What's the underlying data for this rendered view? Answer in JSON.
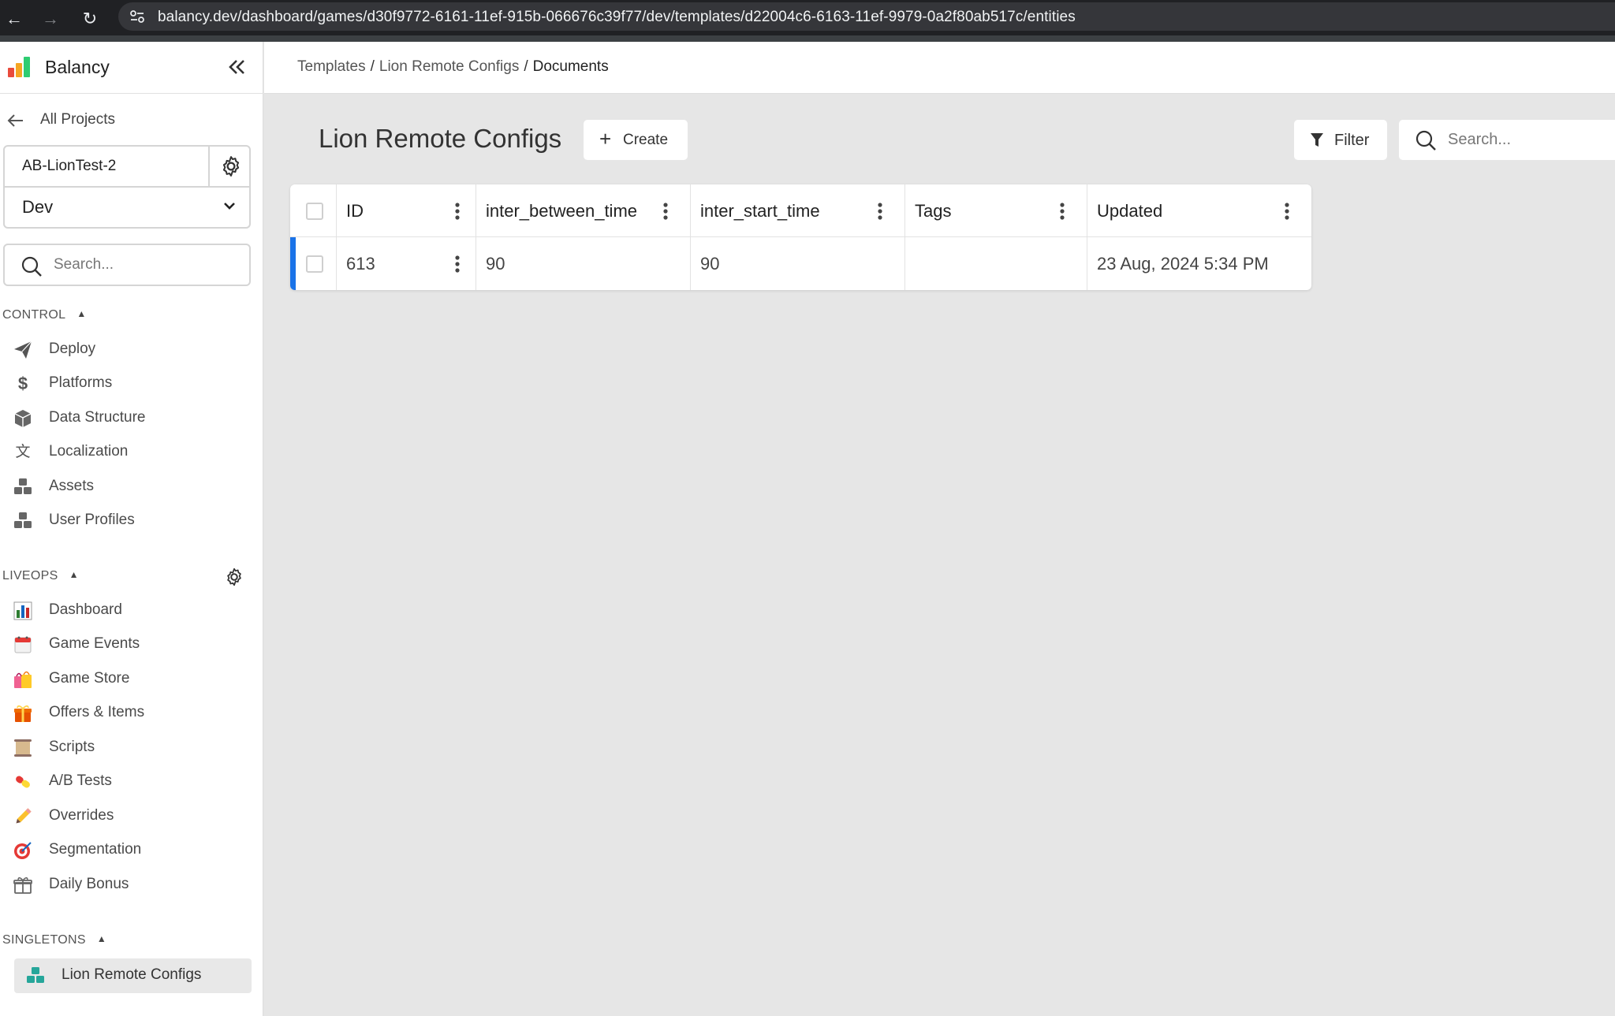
{
  "browser": {
    "url": "balancy.dev/dashboard/games/d30f9772-6161-11ef-915b-066676c39f77/dev/templates/d22004c6-6163-11ef-9979-0a2f80ab517c/entities"
  },
  "sidebar": {
    "brand": "Balancy",
    "all_projects": "All Projects",
    "project_name": "AB-LionTest-2",
    "environment": "Dev",
    "search_placeholder": "Search...",
    "control": {
      "title": "CONTROL",
      "items": [
        {
          "label": "Deploy",
          "icon": "paper-plane-icon"
        },
        {
          "label": "Platforms",
          "icon": "dollar-icon"
        },
        {
          "label": "Data Structure",
          "icon": "cube-icon"
        },
        {
          "label": "Localization",
          "icon": "translate-icon"
        },
        {
          "label": "Assets",
          "icon": "cubes-icon"
        },
        {
          "label": "User Profiles",
          "icon": "cubes-icon"
        }
      ]
    },
    "liveops": {
      "title": "LIVEOPS",
      "items": [
        {
          "label": "Dashboard",
          "icon": "bar-chart-icon"
        },
        {
          "label": "Game Events",
          "icon": "calendar-icon"
        },
        {
          "label": "Game Store",
          "icon": "shopping-bags-icon"
        },
        {
          "label": "Offers & Items",
          "icon": "gift-icon"
        },
        {
          "label": "Scripts",
          "icon": "scroll-icon"
        },
        {
          "label": "A/B Tests",
          "icon": "pill-icon"
        },
        {
          "label": "Overrides",
          "icon": "pencil-icon"
        },
        {
          "label": "Segmentation",
          "icon": "target-icon"
        },
        {
          "label": "Daily Bonus",
          "icon": "gift-outline-icon"
        }
      ]
    },
    "singletons": {
      "title": "SINGLETONS",
      "items": [
        {
          "label": "Lion Remote Configs",
          "icon": "cubes-icon",
          "active": true
        }
      ]
    }
  },
  "breadcrumb": {
    "items": [
      "Templates",
      "Lion Remote Configs",
      "Documents"
    ]
  },
  "main": {
    "title": "Lion Remote Configs",
    "create_label": "Create",
    "filter_label": "Filter",
    "search_placeholder": "Search..."
  },
  "table": {
    "columns": [
      "ID",
      "inter_between_time",
      "inter_start_time",
      "Tags",
      "Updated"
    ],
    "rows": [
      {
        "id": "613",
        "inter_between_time": "90",
        "inter_start_time": "90",
        "tags": "",
        "updated": "23 Aug, 2024 5:34 PM"
      }
    ]
  },
  "colors": {
    "accent": "#1a73e8",
    "sidebar_active_bg": "#e8e8e8",
    "main_bg": "#e6e6e6"
  }
}
